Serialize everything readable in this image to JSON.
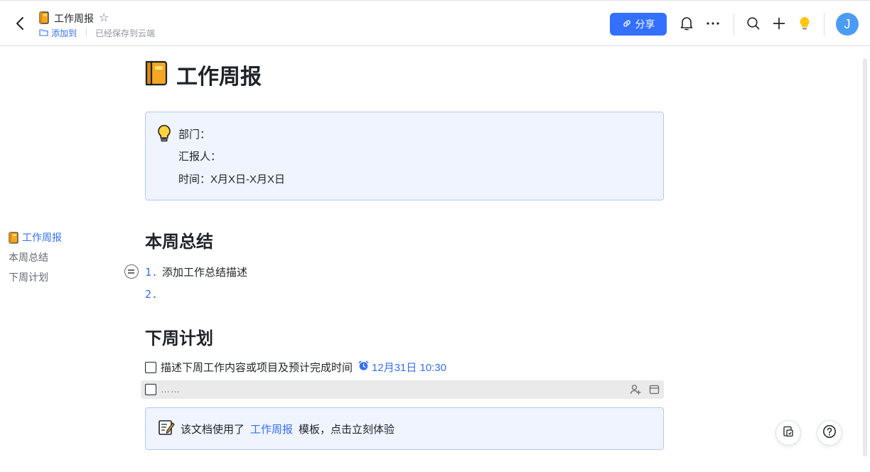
{
  "header": {
    "doc_title": "工作周报",
    "add_to": "添加到",
    "saved_status": "已经保存到云端",
    "share_label": "分享",
    "avatar_letter": "J"
  },
  "document": {
    "title": "工作周报",
    "callout": {
      "department": "部门：",
      "reporter": "汇报人：",
      "time": "时间：X月X日-X月X日"
    },
    "section1": {
      "heading": "本周总结",
      "items": [
        {
          "num": "1.",
          "text": "添加工作总结描述"
        },
        {
          "num": "2.",
          "text": ""
        }
      ]
    },
    "section2": {
      "heading": "下周计划",
      "todo1_text": "描述下周工作内容或项目及预计完成时间",
      "todo1_reminder": "12月31日 10:30",
      "todo2_placeholder": "……"
    },
    "template_banner": {
      "prefix": "该文档使用了",
      "link": "工作周报",
      "suffix": "模板，点击立刻体验"
    }
  },
  "toc": {
    "items": [
      {
        "label": "工作周报",
        "active": true
      },
      {
        "label": "本周总结",
        "active": false
      },
      {
        "label": "下周计划",
        "active": false
      }
    ]
  },
  "colors": {
    "accent": "#3370ff",
    "callout_bg": "#f0f4ff",
    "callout_border": "#b4c8f5",
    "text": "#1f2329",
    "muted": "#646a73"
  },
  "icons": [
    "back-icon",
    "notebook-icon",
    "star-icon",
    "folder-icon",
    "link-icon",
    "bell-icon",
    "more-icon",
    "search-icon",
    "plus-icon",
    "lightbulb-icon",
    "list-handle-icon",
    "alarm-icon",
    "assign-user-icon",
    "calendar-icon",
    "memo-icon",
    "template-icon",
    "help-icon"
  ]
}
